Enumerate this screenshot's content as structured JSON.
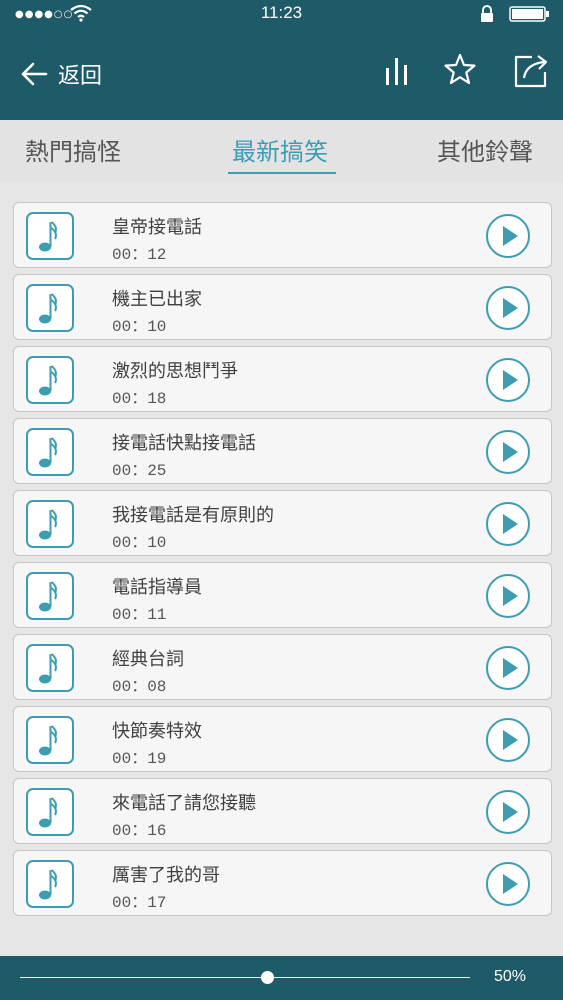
{
  "status_bar": {
    "time": "11:23",
    "signal": "●●●●○○"
  },
  "header": {
    "back_label": "返回",
    "icons": [
      "back-arrow-icon",
      "equalizer-icon",
      "star-icon",
      "share-icon"
    ]
  },
  "tabs": [
    {
      "label": "熱門搞怪",
      "active": false
    },
    {
      "label": "最新搞笑",
      "active": true
    },
    {
      "label": "其他鈴聲",
      "active": false
    }
  ],
  "ringtones": [
    {
      "title": "皇帝接電話",
      "duration": "00：12"
    },
    {
      "title": "機主已出家",
      "duration": "00：10"
    },
    {
      "title": "激烈的思想鬥爭",
      "duration": "00：18"
    },
    {
      "title": "接電話快點接電話",
      "duration": "00：25"
    },
    {
      "title": "我接電話是有原則的",
      "duration": "00：10"
    },
    {
      "title": "電話指導員",
      "duration": "00：11"
    },
    {
      "title": "經典台詞",
      "duration": "00：08"
    },
    {
      "title": "快節奏特效",
      "duration": "00：19"
    },
    {
      "title": "來電話了請您接聽",
      "duration": "00：16"
    },
    {
      "title": "厲害了我的哥",
      "duration": "00：17"
    }
  ],
  "volume": {
    "label": "50%",
    "value": 0.5
  },
  "colors": {
    "header_bg": "#1f5a68",
    "accent": "#3d9db0",
    "list_bg": "#e6e6e6"
  }
}
